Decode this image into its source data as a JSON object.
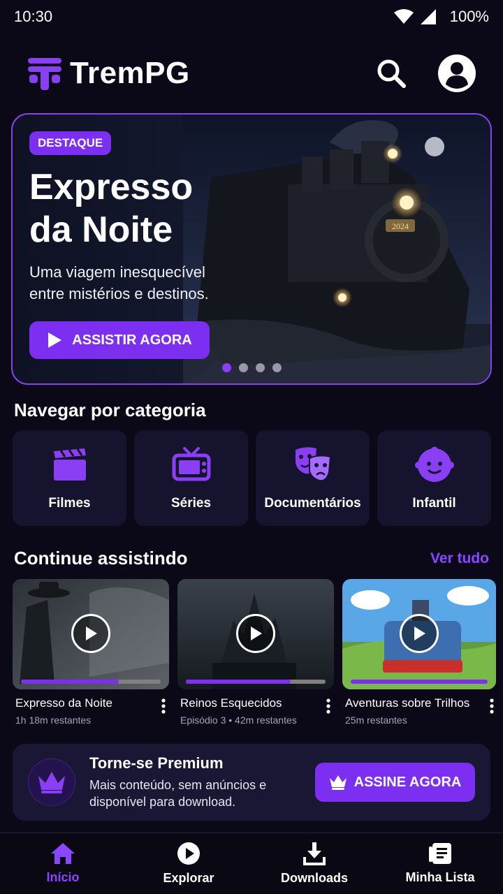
{
  "status_bar": {
    "time": "10:30",
    "battery": "100%"
  },
  "header": {
    "app_name": "TremPG"
  },
  "hero": {
    "badge": "DESTAQUE",
    "title_line1": "Expresso",
    "title_line2": "da Noite",
    "subtitle_line1": "Uma viagem inesquecível",
    "subtitle_line2": "entre mistérios e destinos.",
    "button_label": "ASSISTIR AGORA",
    "locomotive_plate": "2024",
    "carousel_total": 4,
    "carousel_active_index": 0
  },
  "categories": {
    "title": "Navegar por categoria",
    "items": [
      {
        "label": "Filmes",
        "icon": "clapperboard-icon"
      },
      {
        "label": "Séries",
        "icon": "tv-icon"
      },
      {
        "label": "Documentários",
        "icon": "theater-masks-icon"
      },
      {
        "label": "Infantil",
        "icon": "baby-face-icon"
      }
    ]
  },
  "continue_watching": {
    "title": "Continue assistindo",
    "see_all": "Ver tudo",
    "items": [
      {
        "title": "Expresso da Noite",
        "meta": "1h 18m restantes",
        "progress": 0.7
      },
      {
        "title": "Reinos Esquecidos",
        "meta": "Episódio 3 • 42m restantes",
        "progress": 0.75
      },
      {
        "title": "Aventuras sobre Trilhos",
        "meta": "25m restantes",
        "progress": 1.0
      }
    ]
  },
  "premium": {
    "title": "Torne-se Premium",
    "desc_line1": "Mais conteúdo, sem anúncios e",
    "desc_line2": "disponível para download.",
    "button_label": "ASSINE AGORA"
  },
  "bottom_nav": {
    "items": [
      {
        "label": "Início",
        "icon": "home-icon",
        "active": true
      },
      {
        "label": "Explorar",
        "icon": "play-circle-icon",
        "active": false
      },
      {
        "label": "Downloads",
        "icon": "download-icon",
        "active": false
      },
      {
        "label": "Minha Lista",
        "icon": "list-icon",
        "active": false
      }
    ]
  },
  "colors": {
    "background": "#0b0918",
    "accent": "#7c2ff0",
    "accent_text": "#8b46ff",
    "card": "#16132e"
  }
}
